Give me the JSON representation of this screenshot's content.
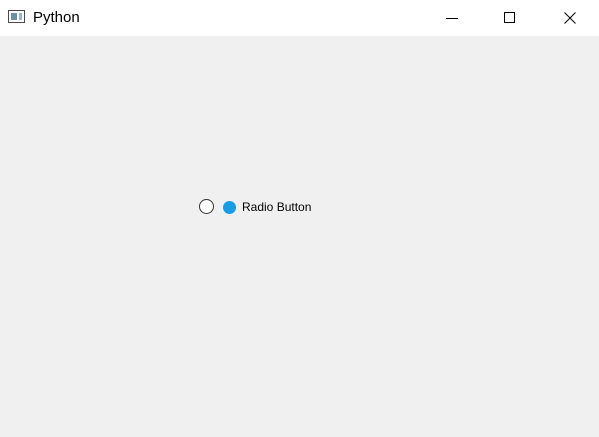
{
  "window": {
    "title": "Python",
    "controls": {
      "minimize_icon": "minimize-icon",
      "maximize_icon": "maximize-icon",
      "close_icon": "close-icon"
    }
  },
  "radio": {
    "label": "Radio Button",
    "checked": false,
    "icon": "filled-circle-icon",
    "icon_color": "#1a9be6"
  },
  "colors": {
    "client_background": "#f0f0f0",
    "titlebar_background": "#ffffff"
  }
}
